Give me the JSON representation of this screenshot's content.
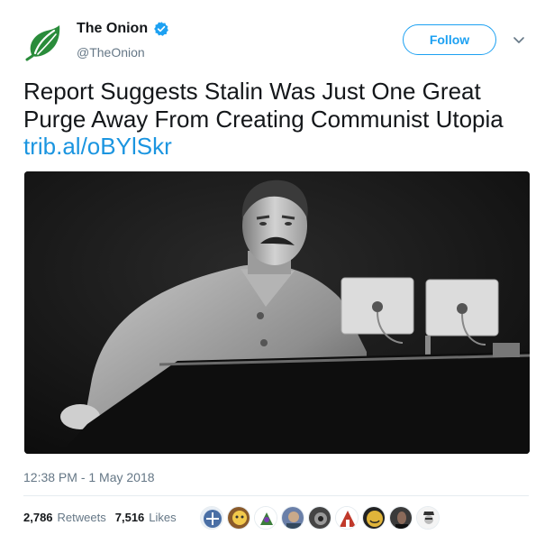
{
  "author": {
    "display_name": "The Onion",
    "handle": "@TheOnion",
    "verified": true,
    "avatar_icon": "onion-logo-icon",
    "brand_color": "#2a8c3b"
  },
  "actions": {
    "follow_label": "Follow",
    "menu_icon": "chevron-down-icon"
  },
  "tweet": {
    "text_lines": [
      "Report Suggests Stalin Was Just One Great",
      "Purge Away From Creating Communist Utopia"
    ],
    "link": "trib.al/oBYlSkr",
    "timestamp": "12:38 PM - 1 May 2018"
  },
  "stats": {
    "retweets_count": "2,786",
    "retweets_label": "Retweets",
    "likes_count": "7,516",
    "likes_label": "Likes"
  },
  "likers": [
    {
      "name": "liker-avatar-1",
      "color": "#4a6fa5"
    },
    {
      "name": "liker-avatar-2",
      "color": "#d9a441"
    },
    {
      "name": "liker-avatar-3",
      "color": "#3b7d3b"
    },
    {
      "name": "liker-avatar-4",
      "color": "#6a7fa8"
    },
    {
      "name": "liker-avatar-5",
      "color": "#444444"
    },
    {
      "name": "liker-avatar-6",
      "color": "#c0392b"
    },
    {
      "name": "liker-avatar-7",
      "color": "#e0b43a"
    },
    {
      "name": "liker-avatar-8",
      "color": "#3a3a3a"
    },
    {
      "name": "liker-avatar-9",
      "color": "#bbbbbb"
    }
  ],
  "colors": {
    "link": "#1b95e0",
    "follow": "#1da1f2",
    "muted": "#657786"
  }
}
